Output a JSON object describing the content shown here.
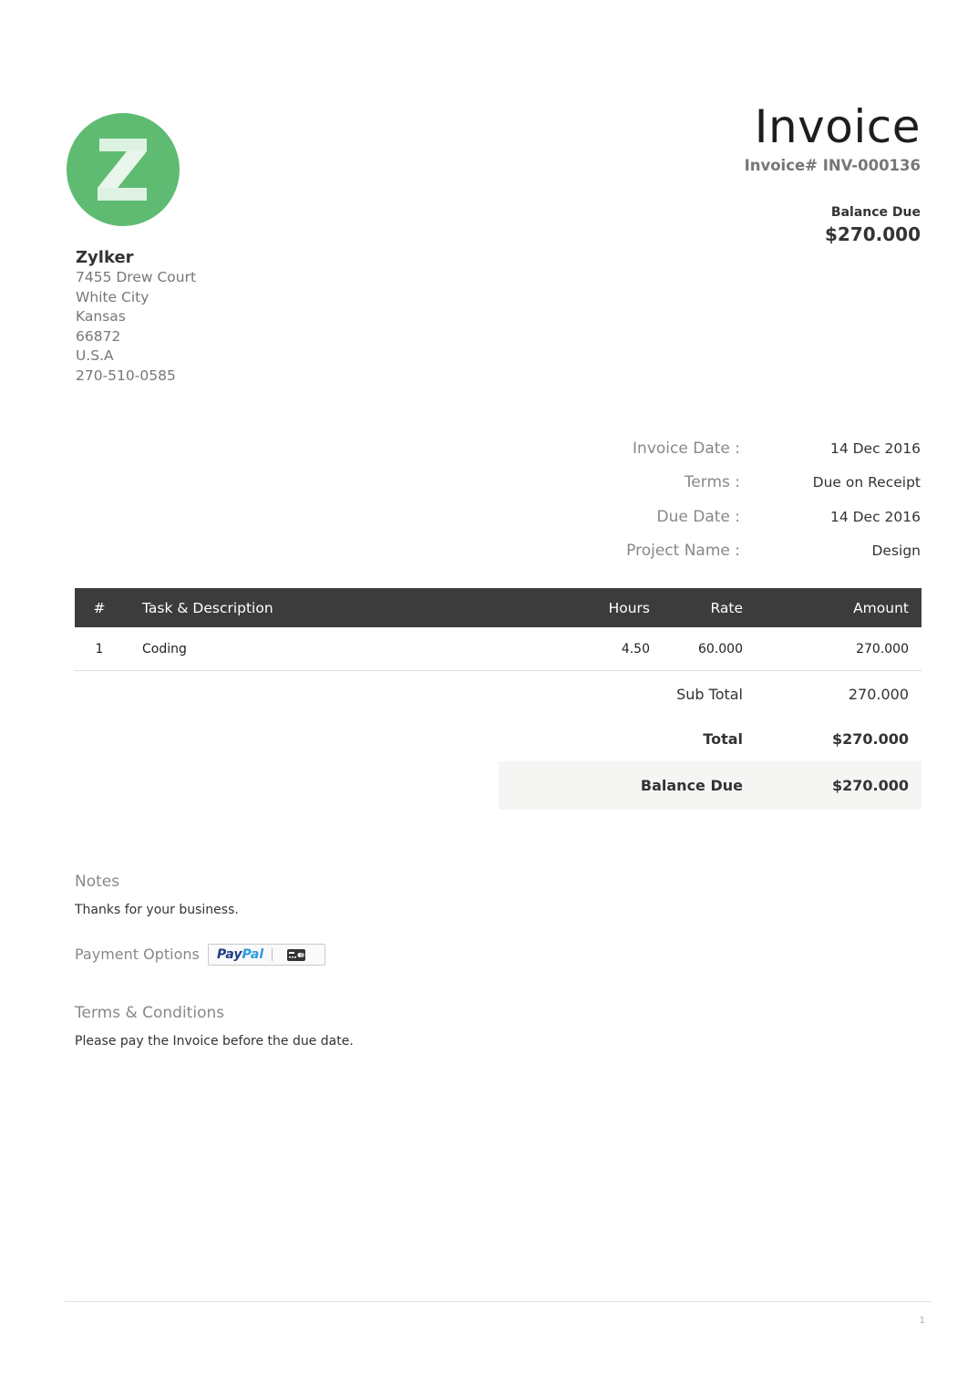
{
  "logo": {
    "letter": "Z",
    "color": "#5fbb72"
  },
  "company": {
    "name": "Zylker",
    "address": [
      "7455 Drew Court",
      "White City",
      "Kansas",
      "66872",
      "U.S.A",
      "270-510-0585"
    ]
  },
  "invoice": {
    "title": "Invoice",
    "number": "Invoice# INV-000136",
    "balance_due_label": "Balance Due",
    "balance_due_amount": "$270.000"
  },
  "meta": [
    {
      "label": "Invoice Date :",
      "value": "14 Dec 2016"
    },
    {
      "label": "Terms :",
      "value": "Due on Receipt"
    },
    {
      "label": "Due Date :",
      "value": "14 Dec 2016"
    },
    {
      "label": "Project Name :",
      "value": "Design"
    }
  ],
  "items": {
    "headers": {
      "num": "#",
      "desc": "Task & Description",
      "hours": "Hours",
      "rate": "Rate",
      "amount": "Amount"
    },
    "rows": [
      {
        "num": "1",
        "desc": "Coding",
        "hours": "4.50",
        "rate": "60.000",
        "amount": "270.000"
      }
    ],
    "header_bg": "#3c3c3c"
  },
  "totals": {
    "sub_total_label": "Sub Total",
    "sub_total_value": "270.000",
    "total_label": "Total",
    "total_value": "$270.000",
    "balance_label": "Balance Due",
    "balance_value": "$270.000"
  },
  "notes": {
    "title": "Notes",
    "text": "Thanks for your business."
  },
  "payment": {
    "label": "Payment Options",
    "paypal_part1": "Pay",
    "paypal_part2": "Pal",
    "icons": [
      "paypal-logo",
      "credit-card-icon"
    ]
  },
  "terms": {
    "title": "Terms & Conditions",
    "text": "Please pay the Invoice before the due date."
  },
  "page_number": "1"
}
